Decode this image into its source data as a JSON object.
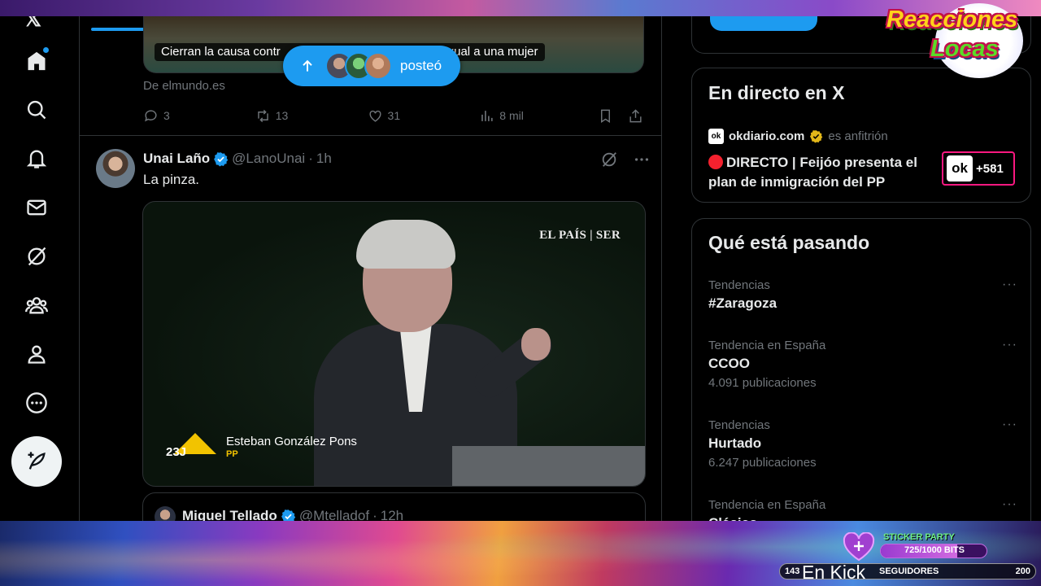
{
  "overlay": {
    "channel_logo_line1": "Reacciones",
    "channel_logo_line2": "Locas",
    "sticker_title": "STICKER PARTY",
    "sticker_progress_text": "725/1000 BITS",
    "sticker_progress": 0.725,
    "followers_current": "143",
    "followers_label": "SEGUIDORES",
    "followers_goal": "200",
    "kick_text": "En Kick"
  },
  "nav": {
    "icons": [
      "x-logo",
      "home-icon",
      "search-icon",
      "notifications-icon",
      "messages-icon",
      "grok-icon",
      "communities-icon",
      "profile-icon",
      "more-icon"
    ],
    "post_icon": "compose-icon"
  },
  "timeline": {
    "prev_post": {
      "caption_part1": "Cierran la causa contr",
      "caption_part2": "esión sexual a una mujer",
      "source": "De elmundo.es",
      "replies": "3",
      "reposts": "13",
      "likes": "31",
      "views": "8 mil"
    },
    "new_posts_pill": {
      "label": "posteó"
    },
    "post": {
      "name": "Unai Laño",
      "handle": "@LanoUnai",
      "sep": "·",
      "time": "1h",
      "text": "La pinza.",
      "video_brand": "EL PAÍS | SER",
      "video_logo_text": "23J",
      "video_person": "Esteban González Pons",
      "video_party": "PP"
    },
    "quote": {
      "name": "Miguel Tellado",
      "handle": "@Mtelladof",
      "sep": "·",
      "time": "12h"
    }
  },
  "sidebar": {
    "live": {
      "title": "En directo en X",
      "host_logo": "ok",
      "host_name": "okdiario.com",
      "host_role": "es anfitrión",
      "text": "DIRECTO | Feijóo presenta el plan de inmigración del PP",
      "badge_logo": "ok",
      "badge_count": "+581"
    },
    "trends": {
      "title": "Qué está pasando",
      "items": [
        {
          "context": "Tendencias",
          "name": "#Zaragoza",
          "count": ""
        },
        {
          "context": "Tendencia en España",
          "name": "CCOO",
          "count": "4.091 publicaciones"
        },
        {
          "context": "Tendencias",
          "name": "Hurtado",
          "count": "6.247 publicaciones"
        },
        {
          "context": "Tendencia en España",
          "name": "Clásico",
          "count": ""
        }
      ],
      "more": "···"
    }
  },
  "colors": {
    "accent": "#1d9bf0",
    "live_red": "#f4212e",
    "live_badge_border": "#f91880",
    "text_primary": "#e7e9ea",
    "text_secondary": "#71767b"
  }
}
